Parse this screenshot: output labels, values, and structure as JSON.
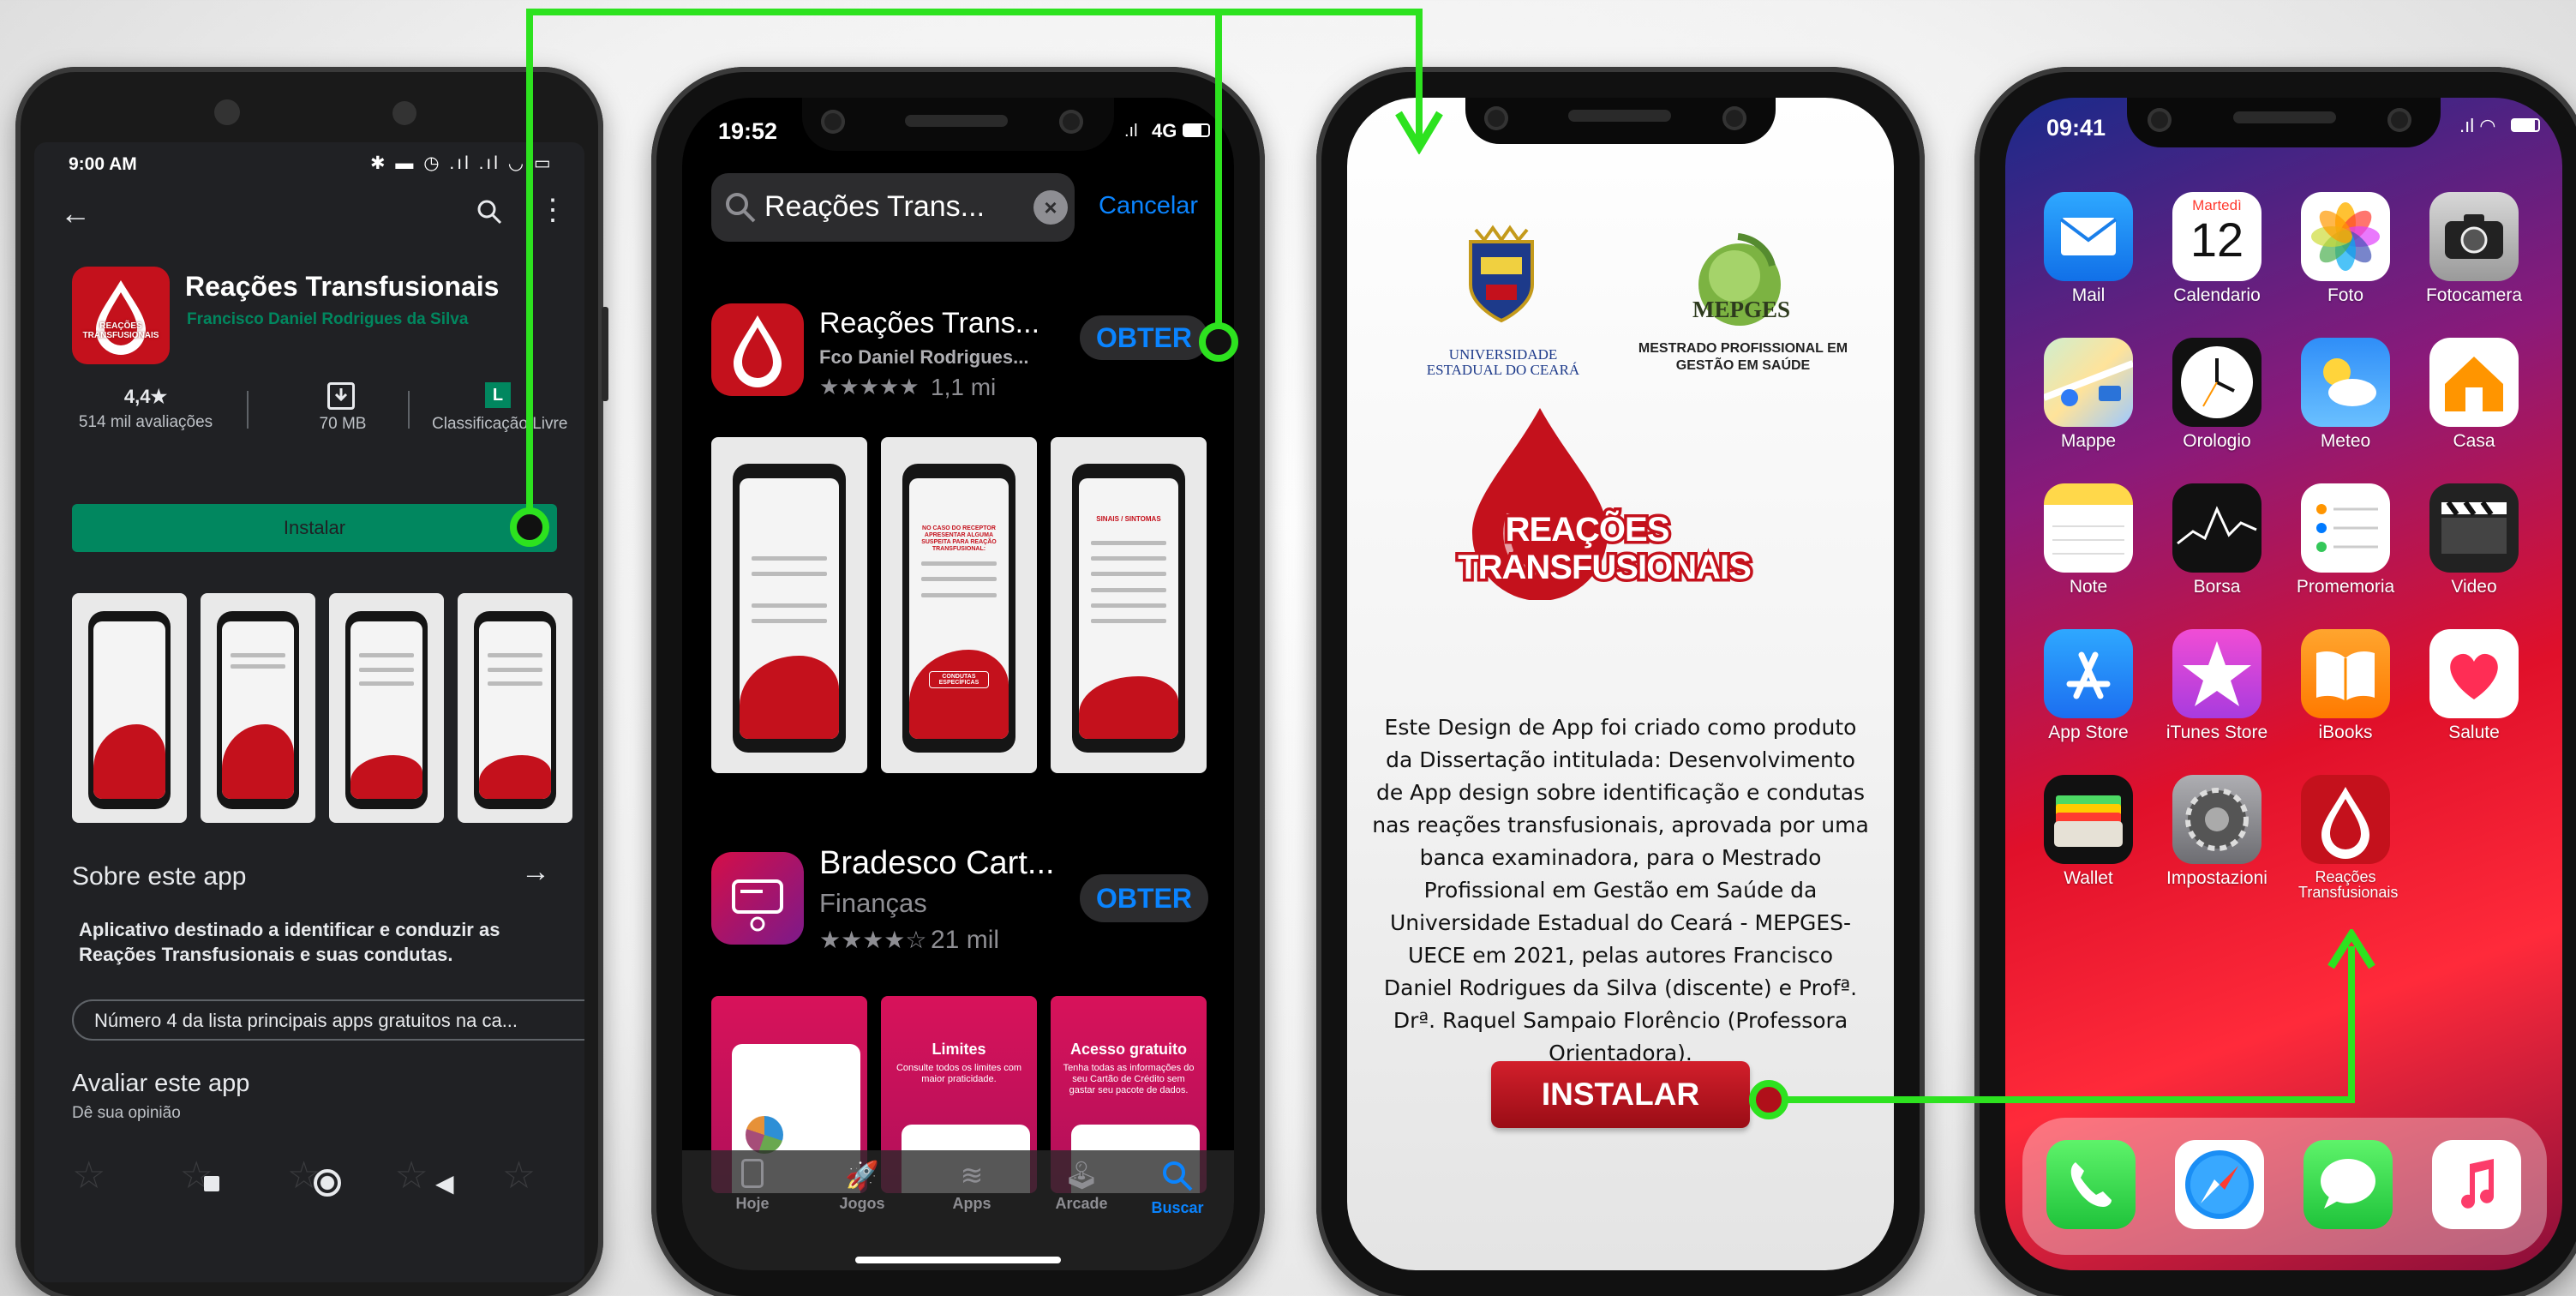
{
  "android": {
    "time": "9:00 AM",
    "app_name": "Reações Transfusionais",
    "developer": "Francisco Daniel Rodrigues da Silva",
    "icon_text": "REAÇÕES TRANSFUSIONAIS",
    "rating": "4,4★",
    "reviews": "514 mil avaliações",
    "size": "70 MB",
    "classification_badge": "L",
    "classification": "Classificação Livre",
    "install_label": "Instalar",
    "about_title": "Sobre este app",
    "about_text": "Aplicativo destinado a identificar e conduzir as Reações Transfusionais e suas condutas.",
    "rank_chip": "Número 4 da lista principais apps gratuitos na ca...",
    "rate_title": "Avaliar este app",
    "rate_subtitle": "Dê sua opinião"
  },
  "appstore": {
    "time": "19:52",
    "network": "4G",
    "search_value": "Reações Trans...",
    "cancel_label": "Cancelar",
    "results": [
      {
        "name": "Reações Trans...",
        "subtitle": "Fco Daniel Rodrigues...",
        "stars": "★★★★★",
        "count": "1,1 mi",
        "button": "OBTER"
      },
      {
        "name": "Bradesco Cart...",
        "subtitle": "Finanças",
        "stars": "★★★★☆",
        "count": "21 mil",
        "button": "OBTER"
      }
    ],
    "screens": [
      {
        "title": "",
        "caption": ""
      },
      {
        "title": "NO CASO DO RECEPTOR APRESENTAR ALGUMA SUSPEITA PARA REAÇÃO TRANSFUSIONAL:",
        "caption": "CONDUTAS ESPECÍFICAS"
      },
      {
        "title": "SINAIS / SINTOMAS",
        "caption": ""
      }
    ],
    "bradesco_screens": [
      {
        "title": "",
        "text": ""
      },
      {
        "title": "Limites",
        "text": "Consulte todos os limites com maior praticidade."
      },
      {
        "title": "Acesso gratuito",
        "text": "Tenha todas as informações do seu Cartão de Crédito sem gastar seu pacote de dados."
      }
    ],
    "tabs": [
      {
        "label": "Hoje"
      },
      {
        "label": "Jogos"
      },
      {
        "label": "Apps"
      },
      {
        "label": "Arcade"
      },
      {
        "label": "Buscar"
      }
    ]
  },
  "splash": {
    "university_line1": "UNIVERSIDADE",
    "university_line2": "ESTADUAL DO CEARÁ",
    "mepges_logo": "MEPGES",
    "mepges_line1": "MESTRADO PROFISSIONAL EM",
    "mepges_line2": "GESTÃO EM SAÚDE",
    "logo_line1": "REAÇÕES",
    "logo_line2": "TRANSFUSIONAIS",
    "description": "Este Design de App foi criado como produto da Dissertação intitulada: Desenvolvimento de App design sobre identificação e condutas nas reações transfusionais, aprovada por uma banca examinadora, para o Mestrado Profissional em Gestão em Saúde da Universidade Estadual do Ceará - MEPGES-UECE em 2021, pelas autores Francisco Daniel Rodrigues da Silva (discente) e Profª. Drª. Raquel Sampaio Florêncio (Professora Orientadora).",
    "install_button": "INSTALAR"
  },
  "ios": {
    "time": "09:41",
    "calendar_day": "Martedì",
    "calendar_date": "12",
    "apps": [
      {
        "label": "Mail",
        "icon": "mail-icon"
      },
      {
        "label": "Calendario",
        "icon": "calendar-icon"
      },
      {
        "label": "Foto",
        "icon": "photos-icon"
      },
      {
        "label": "Fotocamera",
        "icon": "camera-icon"
      },
      {
        "label": "Mappe",
        "icon": "maps-icon"
      },
      {
        "label": "Orologio",
        "icon": "clock-icon"
      },
      {
        "label": "Meteo",
        "icon": "weather-icon"
      },
      {
        "label": "Casa",
        "icon": "home-icon"
      },
      {
        "label": "Note",
        "icon": "notes-icon"
      },
      {
        "label": "Borsa",
        "icon": "stocks-icon"
      },
      {
        "label": "Promemoria",
        "icon": "reminders-icon"
      },
      {
        "label": "Video",
        "icon": "videos-icon"
      },
      {
        "label": "App Store",
        "icon": "appstore-icon"
      },
      {
        "label": "iTunes Store",
        "icon": "itunes-icon"
      },
      {
        "label": "iBooks",
        "icon": "ibooks-icon"
      },
      {
        "label": "Salute",
        "icon": "health-icon"
      },
      {
        "label": "Wallet",
        "icon": "wallet-icon"
      },
      {
        "label": "Impostazioni",
        "icon": "settings-icon"
      },
      {
        "label": "Reações Transfusionais",
        "icon": "reacoes-app-icon"
      }
    ],
    "dock": [
      "phone-icon",
      "safari-icon",
      "messages-icon",
      "music-icon"
    ]
  },
  "colors": {
    "accent_green": "#2de21f",
    "brand_red": "#c4111c",
    "play_green": "#01875f",
    "ios_blue": "#0a84ff"
  }
}
